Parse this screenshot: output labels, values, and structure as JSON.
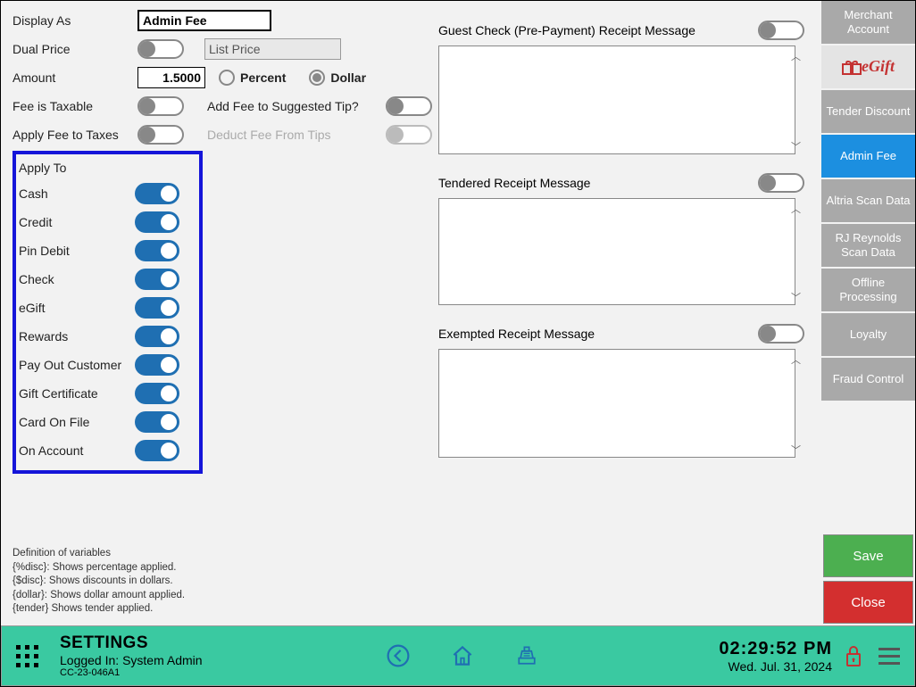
{
  "left": {
    "displayAsLabel": "Display As",
    "displayAsValue": "Admin Fee",
    "dualPriceLabel": "Dual Price",
    "dualPriceValue": "List Price",
    "amountLabel": "Amount",
    "amountValue": "1.5000",
    "percentLabel": "Percent",
    "dollarLabel": "Dollar",
    "feeTaxableLabel": "Fee is Taxable",
    "addFeeTipLabel": "Add Fee to Suggested Tip?",
    "applyFeeTaxesLabel": "Apply Fee to Taxes",
    "deductFeeTipsLabel": "Deduct Fee From Tips"
  },
  "applyTo": {
    "header": "Apply To",
    "items": [
      "Cash",
      "Credit",
      "Pin Debit",
      "Check",
      "eGift",
      "Rewards",
      "Pay Out Customer",
      "Gift Certificate",
      "Card On File",
      "On Account"
    ]
  },
  "defs": {
    "title": "Definition of variables",
    "l1": "{%disc}: Shows percentage applied.",
    "l2": "{$disc}:  Shows discounts in dollars.",
    "l3": "{dollar}: Shows dollar amount applied.",
    "l4": "{tender} Shows tender applied."
  },
  "messages": {
    "guest": "Guest Check (Pre-Payment) Receipt Message",
    "tendered": "Tendered Receipt Message",
    "exempted": "Exempted Receipt Message"
  },
  "sidebar": {
    "merchant": "Merchant Account",
    "egift": "eGift",
    "tender": "Tender Discount",
    "admin": "Admin Fee",
    "altria": "Altria Scan Data",
    "rj": "RJ Reynolds Scan Data",
    "offline": "Offline Processing",
    "loyalty": "Loyalty",
    "fraud": "Fraud Control",
    "save": "Save",
    "close": "Close"
  },
  "footer": {
    "title": "SETTINGS",
    "loggedLabel": "Logged In:  ",
    "loggedUser": "System Admin",
    "terminal": "CC-23-046A1",
    "time": "02:29:52 PM",
    "date": "Wed. Jul. 31, 2024"
  }
}
